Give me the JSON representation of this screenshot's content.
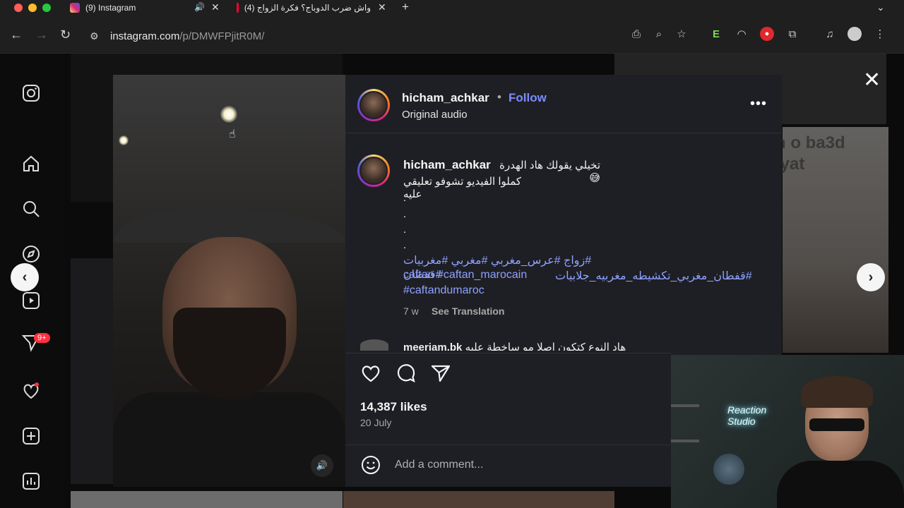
{
  "browser": {
    "tabs": [
      {
        "title": "(9) Instagram",
        "favicon": "instagram-icon"
      },
      {
        "title": "(4) واش ضرب الدوباج؟ فكرة الزواج",
        "favicon": "youtube-icon"
      }
    ],
    "url_host": "instagram.com",
    "url_path": "/p/DMWFPjitR0M/",
    "nav": {
      "back": "←",
      "forward": "→",
      "reload": "↻"
    }
  },
  "sidebar": {
    "messages_badge": "9+"
  },
  "post": {
    "author": "hicham_achkar",
    "follow_label": "Follow",
    "separator": "•",
    "audio": "Original audio",
    "more_label": "•••",
    "caption_line1": "تخيلي يقولك هاد الهدرة 😅",
    "caption_line2": "كملوا الفيديو تشوفو تعليقي عليه",
    "caption_dots": [
      ".",
      ".",
      ".",
      "."
    ],
    "tags_line1": "#زواج #عرس_مغربي #مغربي #مغربيات #قفطان",
    "tags_line2_a": "caftan #caftan_marocain",
    "tags_line2_b": "#قفطان_مغربي_تكشيطه_مغربيه_جلابيات",
    "tags_line3": "#caftandumaroc",
    "age": "7 w",
    "see_translation": "See Translation",
    "comment_user": "meeriam.bk",
    "comment_text": "هاد النوع كتكون اصلا مو ساخطة عليه",
    "likes": "14,387 likes",
    "date": "20 July",
    "add_comment_placeholder": "Add a comment..."
  },
  "background_text": "n o ba3d\niyat",
  "webcam_sign": "Reaction\nStudio",
  "colors": {
    "link": "#7b8cff",
    "panel": "#1e1f24",
    "badge": "#ff3040"
  }
}
